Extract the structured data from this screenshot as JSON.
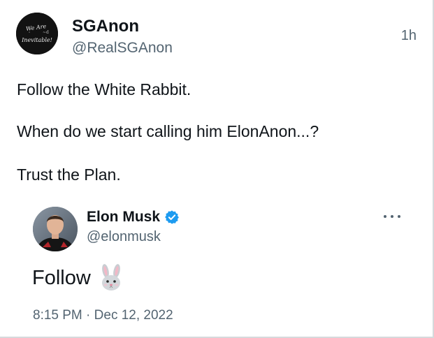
{
  "tweet": {
    "author_name": "SGAnon",
    "author_handle": "@RealSGAnon",
    "time_ago": "1h",
    "avatar_text": [
      "We Are",
      "Inevitable!"
    ],
    "lines": [
      "Follow the White Rabbit.",
      "When do we start calling him ElonAnon...?",
      "Trust the Plan."
    ]
  },
  "quoted_tweet": {
    "author_name": "Elon Musk",
    "author_handle": "@elonmusk",
    "verified": true,
    "text": "Follow",
    "emoji_icon": "rabbit-face-icon",
    "time": "8:15 PM",
    "separator": "·",
    "date": "Dec 12, 2022"
  },
  "colors": {
    "text_primary": "#0f1419",
    "text_secondary": "#536471",
    "verified_blue": "#1d9bf0"
  }
}
